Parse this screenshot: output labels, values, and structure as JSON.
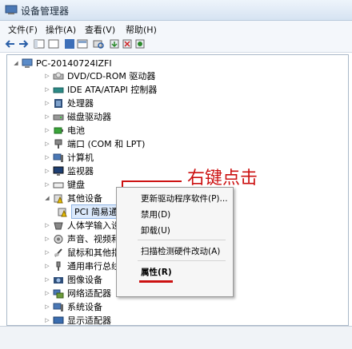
{
  "window": {
    "title": "设备管理器"
  },
  "menu": [
    "文件(F)",
    "操作(A)",
    "查看(V)",
    "帮助(H)"
  ],
  "toolbar_icons": [
    "back-icon",
    "forward-icon",
    "console-tree-icon",
    "help-icon",
    "properties-icon",
    "console-icon",
    "scan-hardware-icon",
    "update-driver-icon",
    "uninstall-icon",
    "disable-icon"
  ],
  "tree": {
    "root": "PC-20140724IZFI",
    "items": [
      "DVD/CD-ROM 驱动器",
      "IDE ATA/ATAPI 控制器",
      "处理器",
      "磁盘驱动器",
      "电池",
      "端口 (COM 和 LPT)",
      "计算机",
      "监视器",
      "键盘",
      "其他设备",
      "人体学输入设备",
      "声音、视频和游戏控制器",
      "鼠标和其他指针设备",
      "通用串行总线控制器",
      "图像设备",
      "网络适配器",
      "系统设备",
      "显示适配器"
    ],
    "child": "PCI 简易通讯控制器"
  },
  "context_menu": [
    "更新驱动程序软件(P)...",
    "禁用(D)",
    "卸载(U)",
    "扫描检测硬件改动(A)",
    "属性(R)"
  ],
  "annotation": "右键点击",
  "colors": {
    "annotation": "#cc1111",
    "selection": "#dbe9fb"
  }
}
